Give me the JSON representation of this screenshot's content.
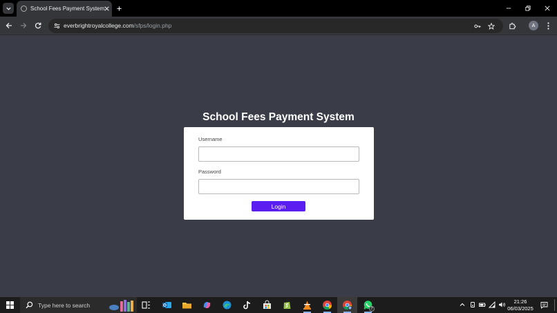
{
  "browser": {
    "tab": {
      "title": "School Fees Payment System"
    },
    "address": {
      "host": "everbrightroyalcollege.com",
      "path": "/sfps/login.php"
    },
    "profile_initial": "A"
  },
  "page": {
    "title": "School Fees Payment System",
    "form": {
      "username_label": "Username",
      "username_value": "",
      "password_label": "Password",
      "password_value": "",
      "submit_label": "Login"
    }
  },
  "taskbar": {
    "search_placeholder": "Type here to search",
    "apps": [
      {
        "icon": "task-view-icon"
      },
      {
        "icon": "outlook-icon"
      },
      {
        "icon": "file-explorer-icon"
      },
      {
        "icon": "copilot-icon"
      },
      {
        "icon": "edge-icon"
      },
      {
        "icon": "tiktok-icon"
      },
      {
        "icon": "microsoft-store-icon"
      },
      {
        "icon": "shopify-icon"
      },
      {
        "icon": "vlc-icon"
      },
      {
        "icon": "chrome-icon"
      },
      {
        "icon": "chrome-profile-icon"
      },
      {
        "icon": "whatsapp-icon",
        "badge": "7"
      }
    ],
    "clock": {
      "time": "21:26",
      "date": "06/03/2025"
    }
  },
  "colors": {
    "page_background": "#3a3d47",
    "card_background": "#ffffff",
    "login_button": "#5a1ef0",
    "tabstrip": "#000000",
    "toolbar": "#35363a",
    "taskbar": "#1c1c1c"
  }
}
